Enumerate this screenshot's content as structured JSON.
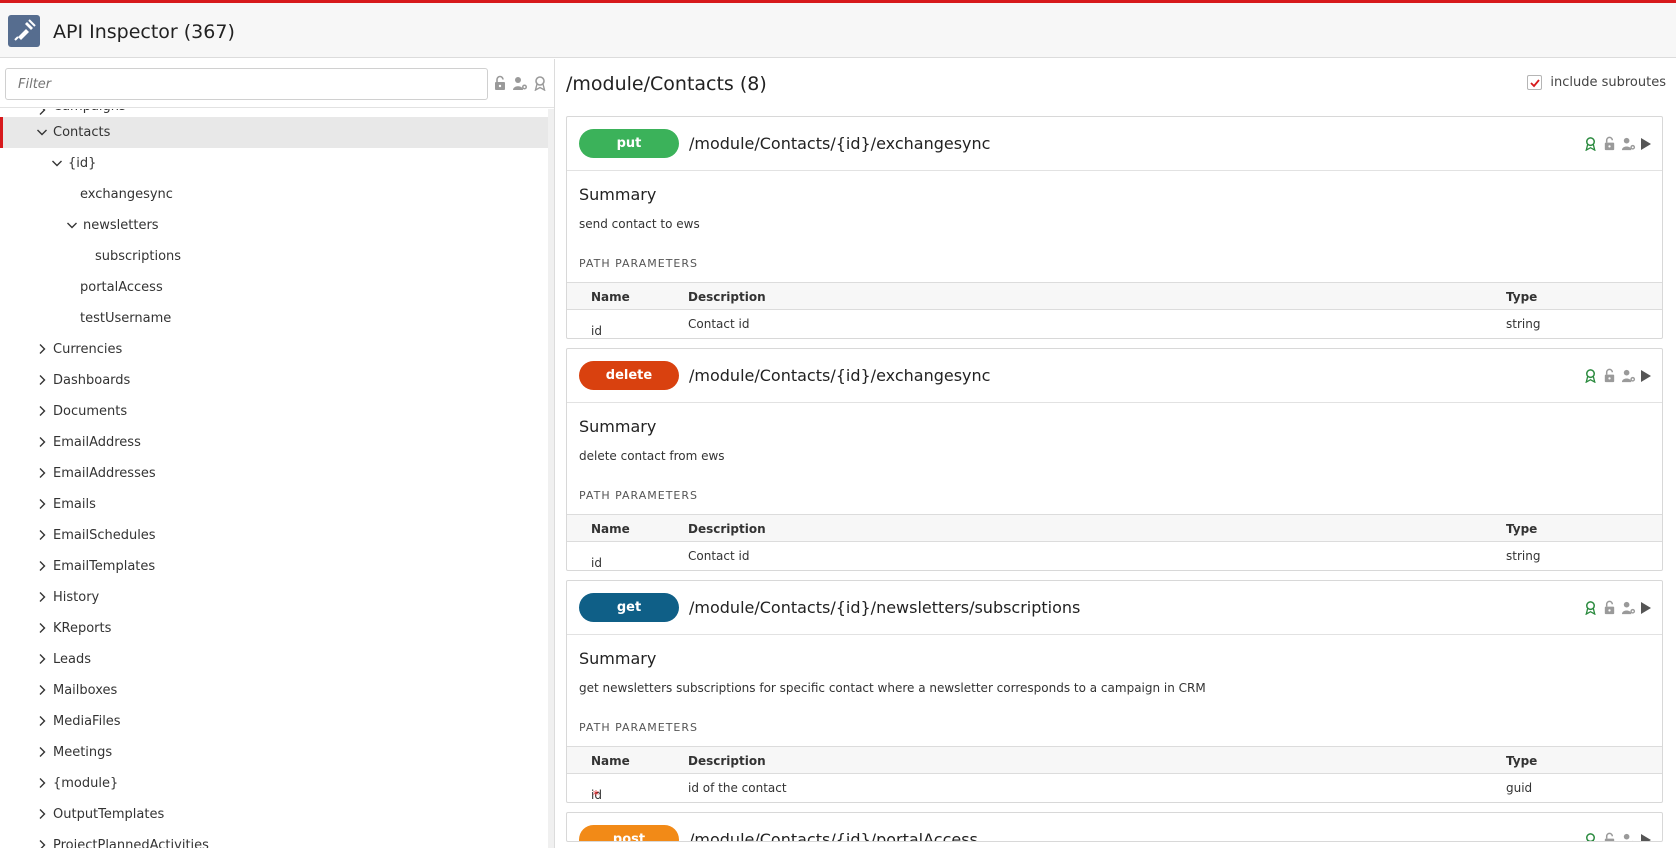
{
  "app": {
    "title": "API Inspector (367)"
  },
  "colors": {
    "accent": "#d7191c",
    "put": "#3bb25a",
    "delete": "#d9410f",
    "get": "#0f5f87",
    "post": "#f28a17",
    "icon_green": "#2a8a3e",
    "icon_grey": "#9a9a9a"
  },
  "sidebar": {
    "filter_placeholder": "Filter",
    "filter_value": "",
    "tree": [
      {
        "label": "Campaigns",
        "depth": 0,
        "state": "collapsed",
        "clip": true
      },
      {
        "label": "Contacts",
        "depth": 0,
        "state": "expanded",
        "selected": true
      },
      {
        "label": "{id}",
        "depth": 1,
        "state": "expanded"
      },
      {
        "label": "exchangesync",
        "depth": 2,
        "state": "leaf"
      },
      {
        "label": "newsletters",
        "depth": 2,
        "state": "expanded"
      },
      {
        "label": "subscriptions",
        "depth": 3,
        "state": "leaf"
      },
      {
        "label": "portalAccess",
        "depth": 2,
        "state": "leaf"
      },
      {
        "label": "testUsername",
        "depth": 2,
        "state": "leaf"
      },
      {
        "label": "Currencies",
        "depth": 0,
        "state": "collapsed"
      },
      {
        "label": "Dashboards",
        "depth": 0,
        "state": "collapsed"
      },
      {
        "label": "Documents",
        "depth": 0,
        "state": "collapsed"
      },
      {
        "label": "EmailAddress",
        "depth": 0,
        "state": "collapsed"
      },
      {
        "label": "EmailAddresses",
        "depth": 0,
        "state": "collapsed"
      },
      {
        "label": "Emails",
        "depth": 0,
        "state": "collapsed"
      },
      {
        "label": "EmailSchedules",
        "depth": 0,
        "state": "collapsed"
      },
      {
        "label": "EmailTemplates",
        "depth": 0,
        "state": "collapsed"
      },
      {
        "label": "History",
        "depth": 0,
        "state": "collapsed"
      },
      {
        "label": "KReports",
        "depth": 0,
        "state": "collapsed"
      },
      {
        "label": "Leads",
        "depth": 0,
        "state": "collapsed"
      },
      {
        "label": "Mailboxes",
        "depth": 0,
        "state": "collapsed"
      },
      {
        "label": "MediaFiles",
        "depth": 0,
        "state": "collapsed"
      },
      {
        "label": "Meetings",
        "depth": 0,
        "state": "collapsed"
      },
      {
        "label": "{module}",
        "depth": 0,
        "state": "collapsed"
      },
      {
        "label": "OutputTemplates",
        "depth": 0,
        "state": "collapsed"
      },
      {
        "label": "ProjectPlannedActivities",
        "depth": 0,
        "state": "collapsed"
      }
    ]
  },
  "main": {
    "route_title": "/module/Contacts (8)",
    "include_subroutes_label": "include subroutes",
    "include_subroutes_checked": true,
    "labels": {
      "summary": "Summary",
      "path_parameters": "PATH PARAMETERS",
      "col_name": "Name",
      "col_description": "Description",
      "col_type": "Type"
    },
    "endpoints": [
      {
        "method": "put",
        "path": "/module/Contacts/{id}/exchangesync",
        "summary": "send contact to ews",
        "params": [
          {
            "name": "id",
            "required": false,
            "description": "Contact id",
            "type": "string"
          }
        ]
      },
      {
        "method": "delete",
        "path": "/module/Contacts/{id}/exchangesync",
        "summary": "delete contact from ews",
        "params": [
          {
            "name": "id",
            "required": false,
            "description": "Contact id",
            "type": "string"
          }
        ]
      },
      {
        "method": "get",
        "path": "/module/Contacts/{id}/newsletters/subscriptions",
        "summary": "get newsletters subscriptions for specific contact where a newsletter corresponds to a campaign in CRM",
        "params": [
          {
            "name": "id",
            "required": true,
            "description": "id of the contact",
            "type": "guid"
          }
        ]
      },
      {
        "method": "post",
        "path": "/module/Contacts/{id}/portalAccess",
        "summary": "",
        "params": [],
        "partial": true
      }
    ]
  }
}
